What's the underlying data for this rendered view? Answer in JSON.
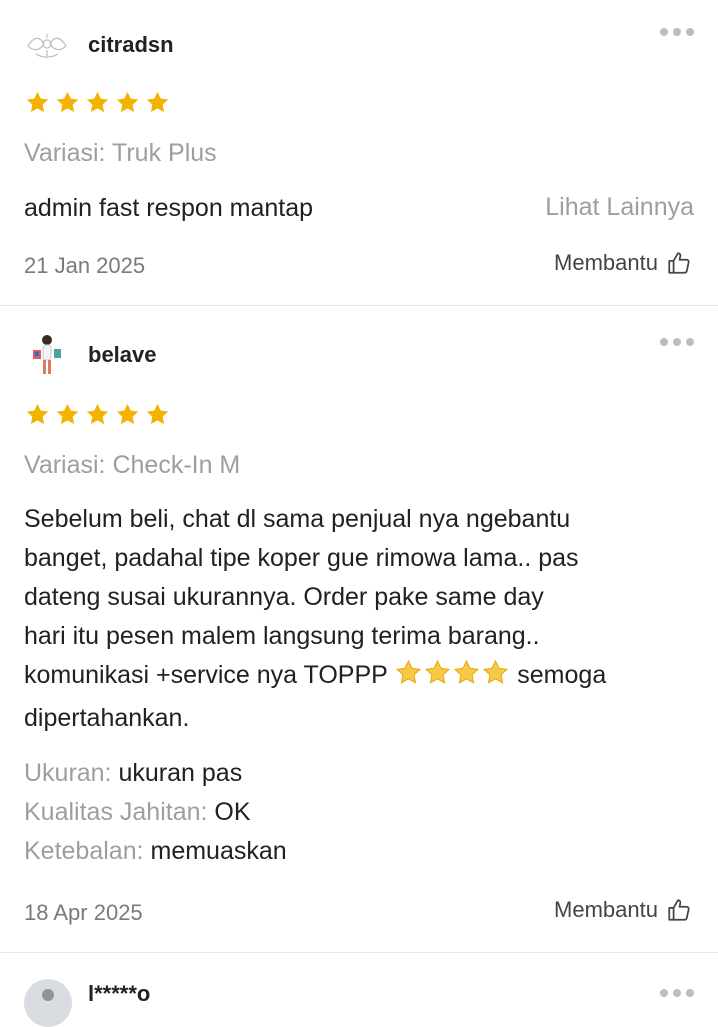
{
  "reviews": [
    {
      "username": "citradsn",
      "rating": 5,
      "variant": "Variasi: Truk Plus",
      "text": "admin fast respon mantap",
      "see_more": "Lihat Lainnya",
      "date": "21 Jan 2025",
      "helpful": "Membantu"
    },
    {
      "username": "belave",
      "rating": 5,
      "variant": "Variasi: Check-In M",
      "text_lines": [
        "Sebelum beli, chat dl sama penjual nya ngebantu",
        "banget, padahal tipe koper gue rimowa lama.. pas",
        "dateng susai ukurannya. Order pake same day",
        "hari itu pesen malem langsung terima barang..",
        "komunikasi +service nya TOPPP",
        "semoga",
        "dipertahankan."
      ],
      "attributes": [
        {
          "label": "Ukuran:",
          "value": "ukuran pas"
        },
        {
          "label": "Kualitas Jahitan:",
          "value": "OK"
        },
        {
          "label": "Ketebalan:",
          "value": "memuaskan"
        }
      ],
      "date": "18 Apr 2025",
      "helpful": "Membantu"
    },
    {
      "username": "l*****o"
    }
  ],
  "colors": {
    "star": "#f5b301",
    "muted": "#9e9e9e",
    "divider": "#e6e6e6"
  }
}
